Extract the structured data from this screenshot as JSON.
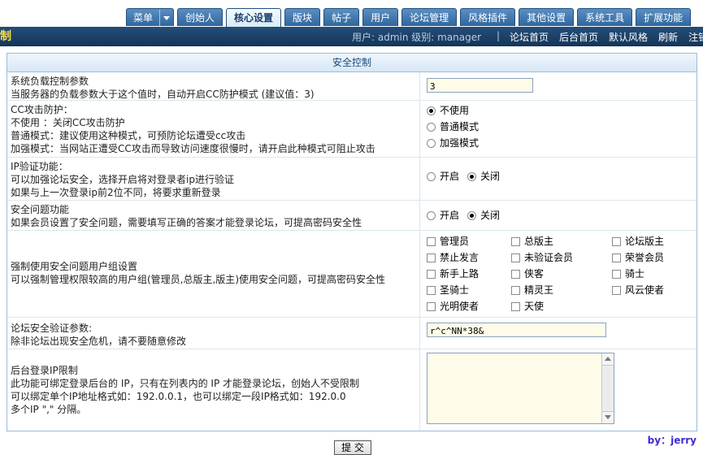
{
  "tabs": [
    {
      "label": "菜单",
      "active": false
    },
    {
      "label": "创始人",
      "active": false
    },
    {
      "label": "核心设置",
      "active": true
    },
    {
      "label": "版块",
      "active": false
    },
    {
      "label": "帖子",
      "active": false
    },
    {
      "label": "用户",
      "active": false
    },
    {
      "label": "论坛管理",
      "active": false
    },
    {
      "label": "风格插件",
      "active": false
    },
    {
      "label": "其他设置",
      "active": false
    },
    {
      "label": "系统工具",
      "active": false
    },
    {
      "label": "扩展功能",
      "active": false
    }
  ],
  "header": {
    "logo": "制",
    "userinfo": "用户: admin 级别: manager",
    "separator": "|",
    "links": [
      "论坛首页",
      "后台首页",
      "默认风格",
      "刷新",
      "注销"
    ]
  },
  "panel": {
    "title": "安全控制"
  },
  "load": {
    "title": "系统负载控制参数",
    "desc": "当服务器的负载参数大于这个值时，自动开启CC防护模式 (建议值：3)",
    "value": "3"
  },
  "cc": {
    "title": "CC攻击防护：",
    "line1": "不使用    ：关闭CC攻击防护",
    "line2": "普通模式：建议使用这种模式，可预防论坛遭受cc攻击",
    "line3": "加强模式：当网站正遭受CC攻击而导致访问速度很慢时，请开启此种模式可阻止攻击",
    "options": [
      {
        "label": "不使用",
        "checked": true
      },
      {
        "label": "普通模式",
        "checked": false
      },
      {
        "label": "加强模式",
        "checked": false
      }
    ]
  },
  "ip": {
    "title": "IP验证功能：",
    "line1": "可以加强论坛安全，选择开启将对登录者ip进行验证",
    "line2": "如果与上一次登录ip前2位不同，将要求重新登录",
    "on_label": "开启",
    "off_label": "关闭",
    "value": "off"
  },
  "question": {
    "title": "安全问题功能",
    "desc": "如果会员设置了安全问题，需要填写正确的答案才能登录论坛，可提高密码安全性",
    "on_label": "开启",
    "off_label": "关闭",
    "value": "off"
  },
  "groups": {
    "title": "强制使用安全问题用户组设置",
    "desc": "可以强制管理权限较高的用户组(管理员,总版主,版主)使用安全问题，可提高密码安全性",
    "items": [
      "管理员",
      "总版主",
      "论坛版主",
      "禁止发言",
      "未验证会员",
      "荣誉会员",
      "新手上路",
      "侠客",
      "骑士",
      "圣骑士",
      "精灵王",
      "风云使者",
      "光明使者",
      "天使"
    ]
  },
  "verify": {
    "title": "论坛安全验证参数:",
    "desc": "除非论坛出现安全危机，请不要随意修改",
    "value": "r^c^NN*38&"
  },
  "iplimit": {
    "title": "后台登录IP限制",
    "line1": "此功能可绑定登录后台的 IP，只有在列表内的 IP 才能登录论坛，创始人不受限制",
    "line2": "可以绑定单个IP地址格式如：192.0.0.1，也可以绑定一段IP格式如：192.0.0",
    "line3": "多个IP \",\" 分隔。",
    "value": ""
  },
  "footer": {
    "by": "by：jerry",
    "submit": "提 交"
  }
}
